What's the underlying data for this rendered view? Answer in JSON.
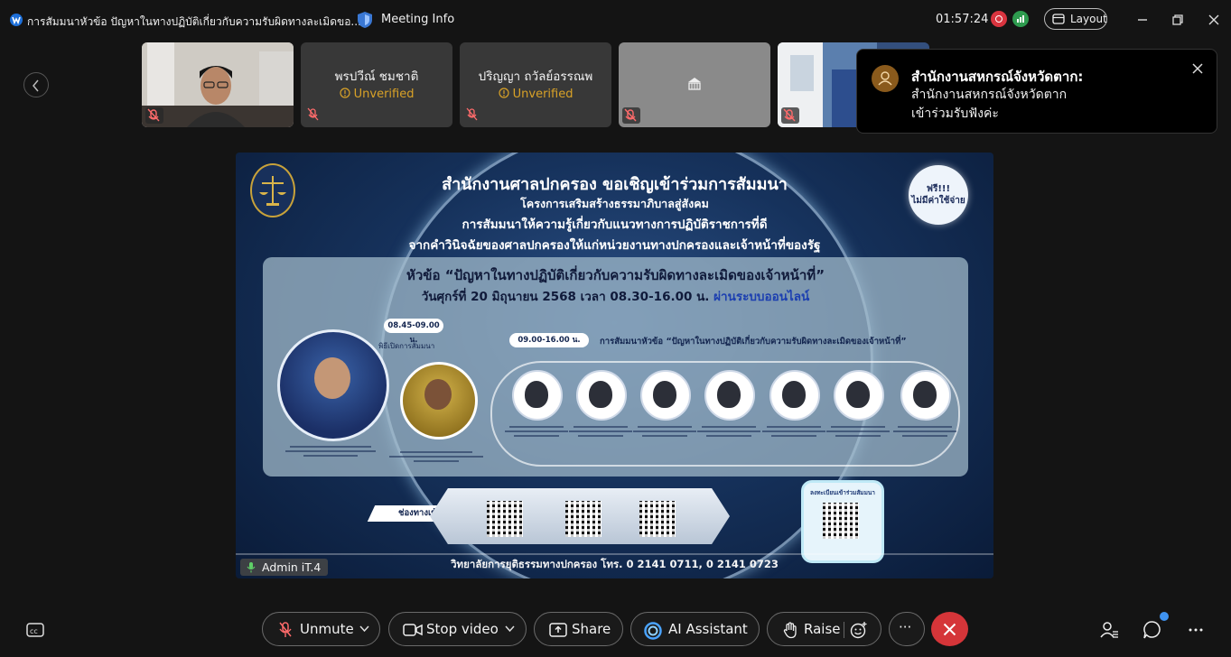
{
  "titlebar": {
    "window_title": "การสัมมนาหัวข้อ ปัญหาในทางปฏิบัติเกี่ยวกับความรับผิดทางละเมิดขอ...",
    "meeting_info_label": "Meeting Info",
    "elapsed_time": "01:57:24",
    "layout_label": "Layout"
  },
  "participants": [
    {
      "name": "",
      "status": "",
      "type": "video"
    },
    {
      "name": "พรปวีณ์  ชมชาติ",
      "status": "Unverified",
      "type": "name"
    },
    {
      "name": "ปริญญา  ถวัลย์อรรณพ",
      "status": "Unverified",
      "type": "name"
    },
    {
      "name": "",
      "status": "",
      "type": "avatar"
    },
    {
      "name": "",
      "status": "",
      "type": "video"
    }
  ],
  "notification": {
    "sender": "สำนักงานสหกรณ์จังหวัดตาก:",
    "line1": "สำนักงานสหกรณ์จังหวัดตาก",
    "line2": "เข้าร่วมรับฟังค่ะ"
  },
  "shared_content": {
    "headline": "สำนักงานศาลปกครอง ขอเชิญเข้าร่วมการสัมมนา",
    "subhead1": "โครงการเสริมสร้างธรรมาภิบาลสู่สังคม",
    "subhead2": "การสัมมนาให้ความรู้เกี่ยวกับแนวทางการปฏิบัติราชการที่ดี",
    "subhead3": "จากคำวินิจฉัยของศาลปกครองให้แก่หน่วยงานทางปกครองและเจ้าหน้าที่ของรัฐ",
    "free_badge_line1": "ฟรี!!!",
    "free_badge_line2": "ไม่มีค่าใช้จ่าย",
    "topic": "หัวข้อ “ปัญหาในทางปฏิบัติเกี่ยวกับความรับผิดทางละเมิดของเจ้าหน้าที่”",
    "date_text": "วันศุกร์ที่ 20 มิถุนายน 2568 เวลา 08.30-16.00 น.",
    "online_text": "ผ่านระบบออนไลน์",
    "opening_time": "08.45-09.00 น.",
    "opening_label": "พิธีเปิดการสัมมนา",
    "session_time": "09.00-16.00 น.",
    "session_label": "การสัมมนาหัวข้อ “ปัญหาในทางปฏิบัติเกี่ยวกับความรับผิดทางละเมิดของเจ้าหน้าที่”",
    "channel_label": "ช่องทางเข้าสัมมนา",
    "register_label": "ลงทะเบียนเข้าร่วมสัมมนา",
    "footer": "วิทยาลัยการยุติธรรมทางปกครอง โทร. 0 2141 0711, 0 2141 0723",
    "presenter": "Admin iT.4"
  },
  "toolbar": {
    "unmute": "Unmute",
    "stop_video": "Stop video",
    "share": "Share",
    "ai_assistant": "AI Assistant",
    "raise": "Raise",
    "more": "···"
  },
  "colors": {
    "background": "#141414",
    "unverified": "#d9a227",
    "end_call": "#d53539",
    "badge_dot": "#3f93f0"
  }
}
